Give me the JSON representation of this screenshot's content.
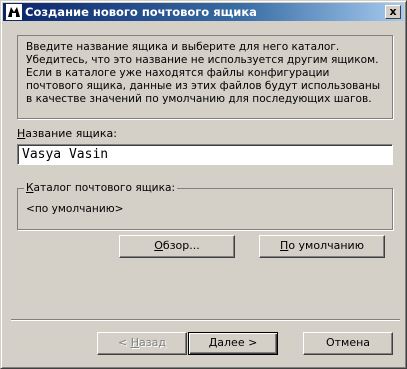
{
  "window": {
    "title": "Создание нового почтового ящика",
    "close_label": "x"
  },
  "intro": {
    "text": "Введите название ящика и выберите для него каталог. Убедитесь, что это название не используется другим ящиком. Если в каталоге уже находятся файлы конфигурации почтового ящика, данные из этих файлов будут использованы в качестве значений по умолчанию для последующих шагов."
  },
  "mailbox_name": {
    "label_underlined": "Н",
    "label_rest": "азвание ящика:",
    "value": "Vasya Vasin"
  },
  "catalog": {
    "label_underlined": "К",
    "label_rest": "аталог почтового ящика:",
    "value": "<по умолчанию>"
  },
  "buttons": {
    "browse_underlined": "О",
    "browse_rest": "бзор...",
    "default_underlined": "П",
    "default_rest": "о умолчанию",
    "back_prefix": "< ",
    "back_underlined": "Н",
    "back_rest": "азад",
    "next_underlined": "Д",
    "next_rest": "алее >",
    "cancel": "Отмена"
  }
}
